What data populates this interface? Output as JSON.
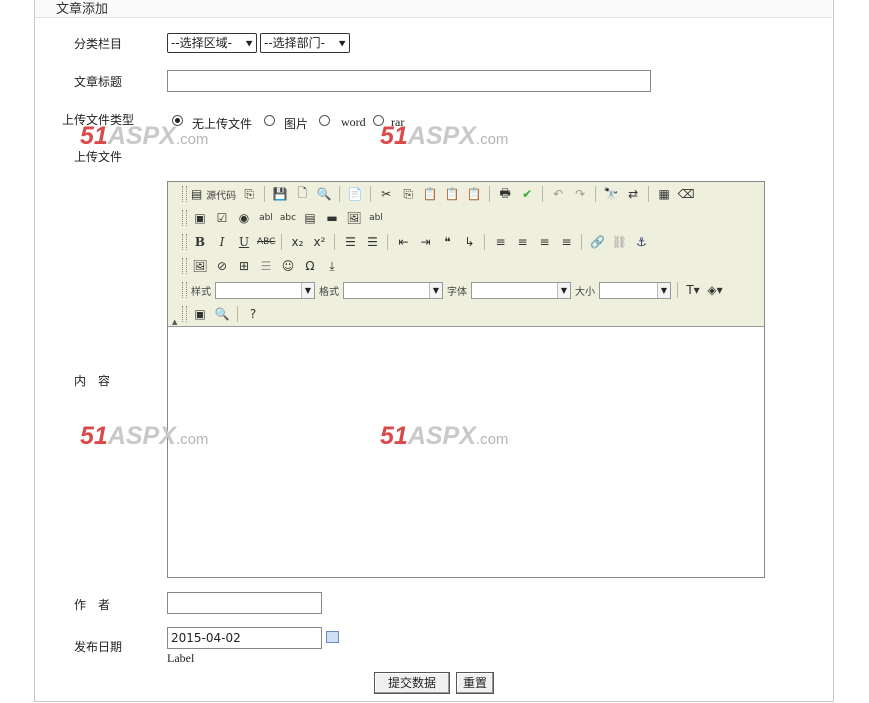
{
  "panel": {
    "title": "文章添加"
  },
  "form": {
    "category_label": "分类栏目",
    "region_select": "--选择区域-",
    "dept_select": "--选择部门-",
    "title_label": "文章标题",
    "title_value": "",
    "upload_type_label": "上传文件类型",
    "upload_types": [
      "无上传文件",
      "图片",
      "word",
      "rar"
    ],
    "upload_selected": "无上传文件",
    "upload_file_label": "上传文件",
    "content_label": "内　容",
    "author_label": "作　者",
    "author_value": "",
    "date_label": "发布日期",
    "date_value": "2015-04-02",
    "date_sub_label": "Label",
    "submit_label": "提交数据",
    "reset_label": "重置"
  },
  "editor": {
    "source_label": "源代码",
    "style_label": "样式",
    "format_label": "格式",
    "font_label": "字体",
    "size_label": "大小",
    "bold_label": "B",
    "italic_label": "I",
    "underline_label": "U",
    "strike_label": "ABC",
    "toolbar_bg": "#efefde"
  },
  "watermark": {
    "num": "51",
    "mid": "ASPX",
    "suffix": ".com",
    "color_num": "#d94a4a"
  }
}
